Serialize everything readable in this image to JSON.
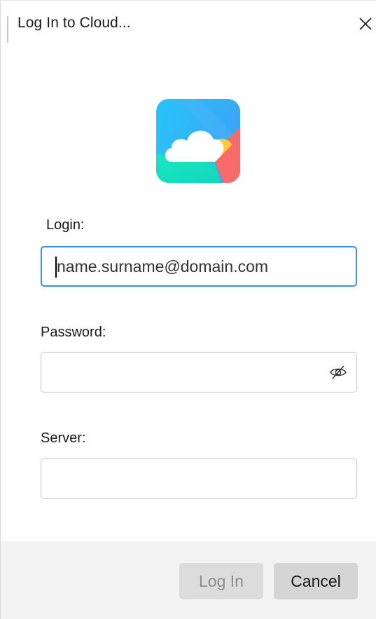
{
  "window": {
    "title": "Log In to Cloud..."
  },
  "icons": {
    "close": "close-icon",
    "logo": "cloud-app-logo-icon",
    "password_visibility": "eye-off-icon"
  },
  "form": {
    "login": {
      "label": "Login:",
      "placeholder": "name.surname@domain.com",
      "value": ""
    },
    "password": {
      "label": "Password:",
      "value": ""
    },
    "server": {
      "label": "Server:",
      "value": ""
    }
  },
  "buttons": {
    "login": "Log In",
    "cancel": "Cancel"
  },
  "colors": {
    "focus_border": "#3d8ee0",
    "footer_bg": "#f3f3f3",
    "logo_top": "#39aef8",
    "logo_bottom": "#14e0bf",
    "logo_yellow": "#ffc93a",
    "logo_red": "#fa6a6a"
  }
}
